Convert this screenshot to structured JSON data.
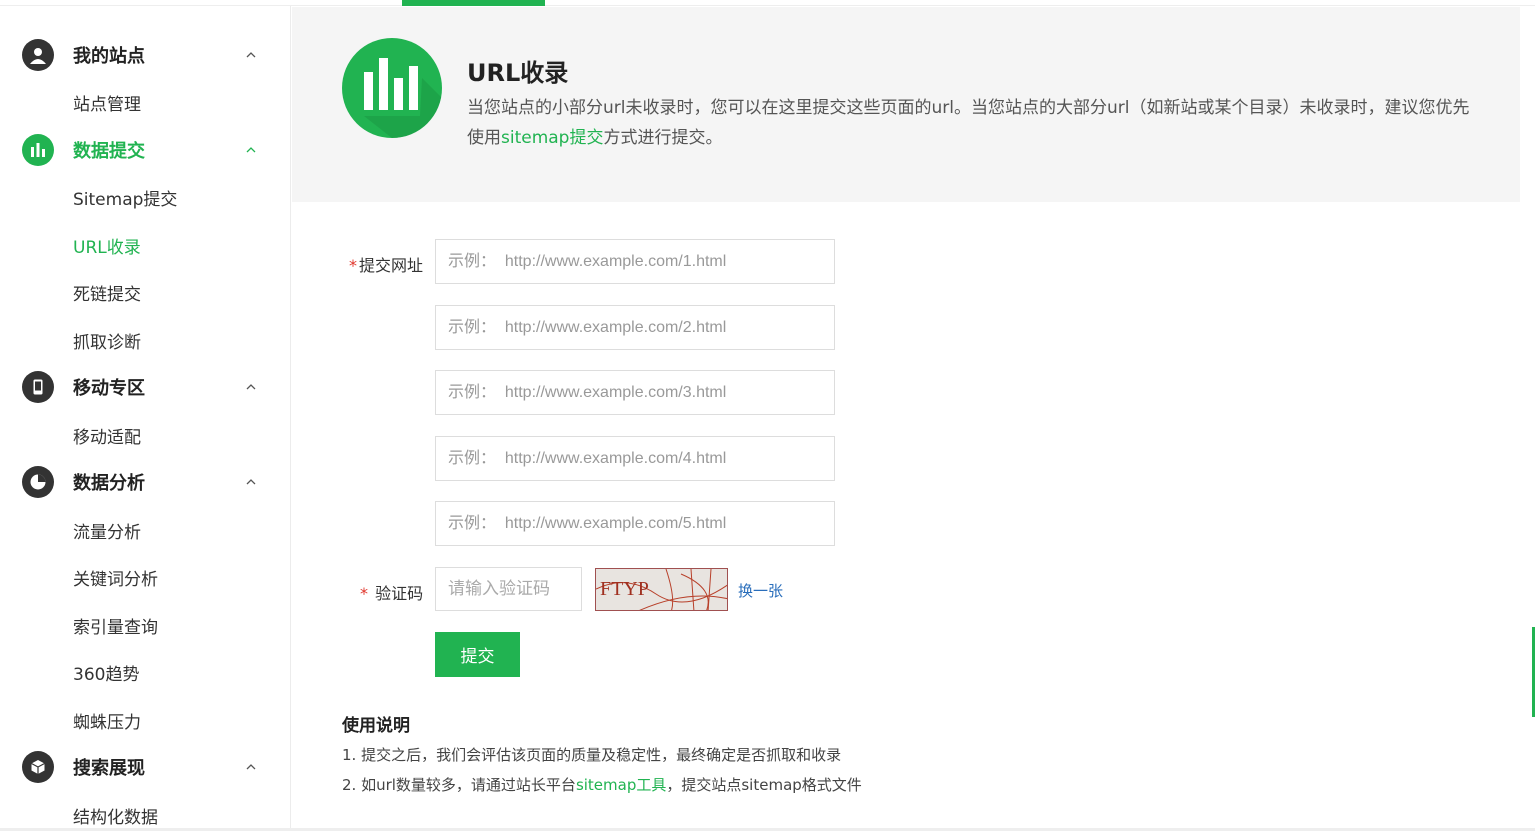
{
  "sidebar": {
    "groups": [
      {
        "label": "我的站点",
        "icon": "user-icon",
        "items": [
          "站点管理"
        ]
      },
      {
        "label": "数据提交",
        "icon": "bar-chart-icon",
        "active": true,
        "items": [
          "Sitemap提交",
          "URL收录",
          "死链提交",
          "抓取诊断"
        ]
      },
      {
        "label": "移动专区",
        "icon": "mobile-icon",
        "items": [
          "移动适配"
        ]
      },
      {
        "label": "数据分析",
        "icon": "pie-chart-icon",
        "items": [
          "流量分析",
          "关键词分析",
          "索引量查询",
          "360趋势",
          "蜘蛛压力"
        ]
      },
      {
        "label": "搜索展现",
        "icon": "cube-icon",
        "items": [
          "结构化数据"
        ]
      }
    ],
    "active_item": "URL收录"
  },
  "header": {
    "title": "URL收录",
    "desc_part1": "当您站点的小部分url未收录时，您可以在这里提交这些页面的url。当您站点的大部分url（如新站或某个目录）未收录时，建议您优先使用",
    "desc_link": "sitemap提交",
    "desc_part2": "方式进行提交。"
  },
  "form": {
    "url_label": "提交网址",
    "url_placeholders": [
      "示例：  http://www.example.com/1.html",
      "示例：  http://www.example.com/2.html",
      "示例：  http://www.example.com/3.html",
      "示例：  http://www.example.com/4.html",
      "示例：  http://www.example.com/5.html"
    ],
    "captcha_label": "验证码",
    "captcha_placeholder": "请输入验证码",
    "captcha_text": "FTYP",
    "refresh_label": "换一张",
    "submit_label": "提交",
    "required_mark": "*"
  },
  "usage": {
    "title": "使用说明",
    "line1": "1. 提交之后，我们会评估该页面的质量及稳定性，最终确定是否抓取和收录",
    "line2_part1": "2. 如url数量较多，请通过站长平台",
    "line2_link": "sitemap工具",
    "line2_part2": "，提交站点sitemap格式文件"
  },
  "colors": {
    "accent": "#21b351",
    "link_blue": "#2a6ebb",
    "required": "#e0352b"
  }
}
